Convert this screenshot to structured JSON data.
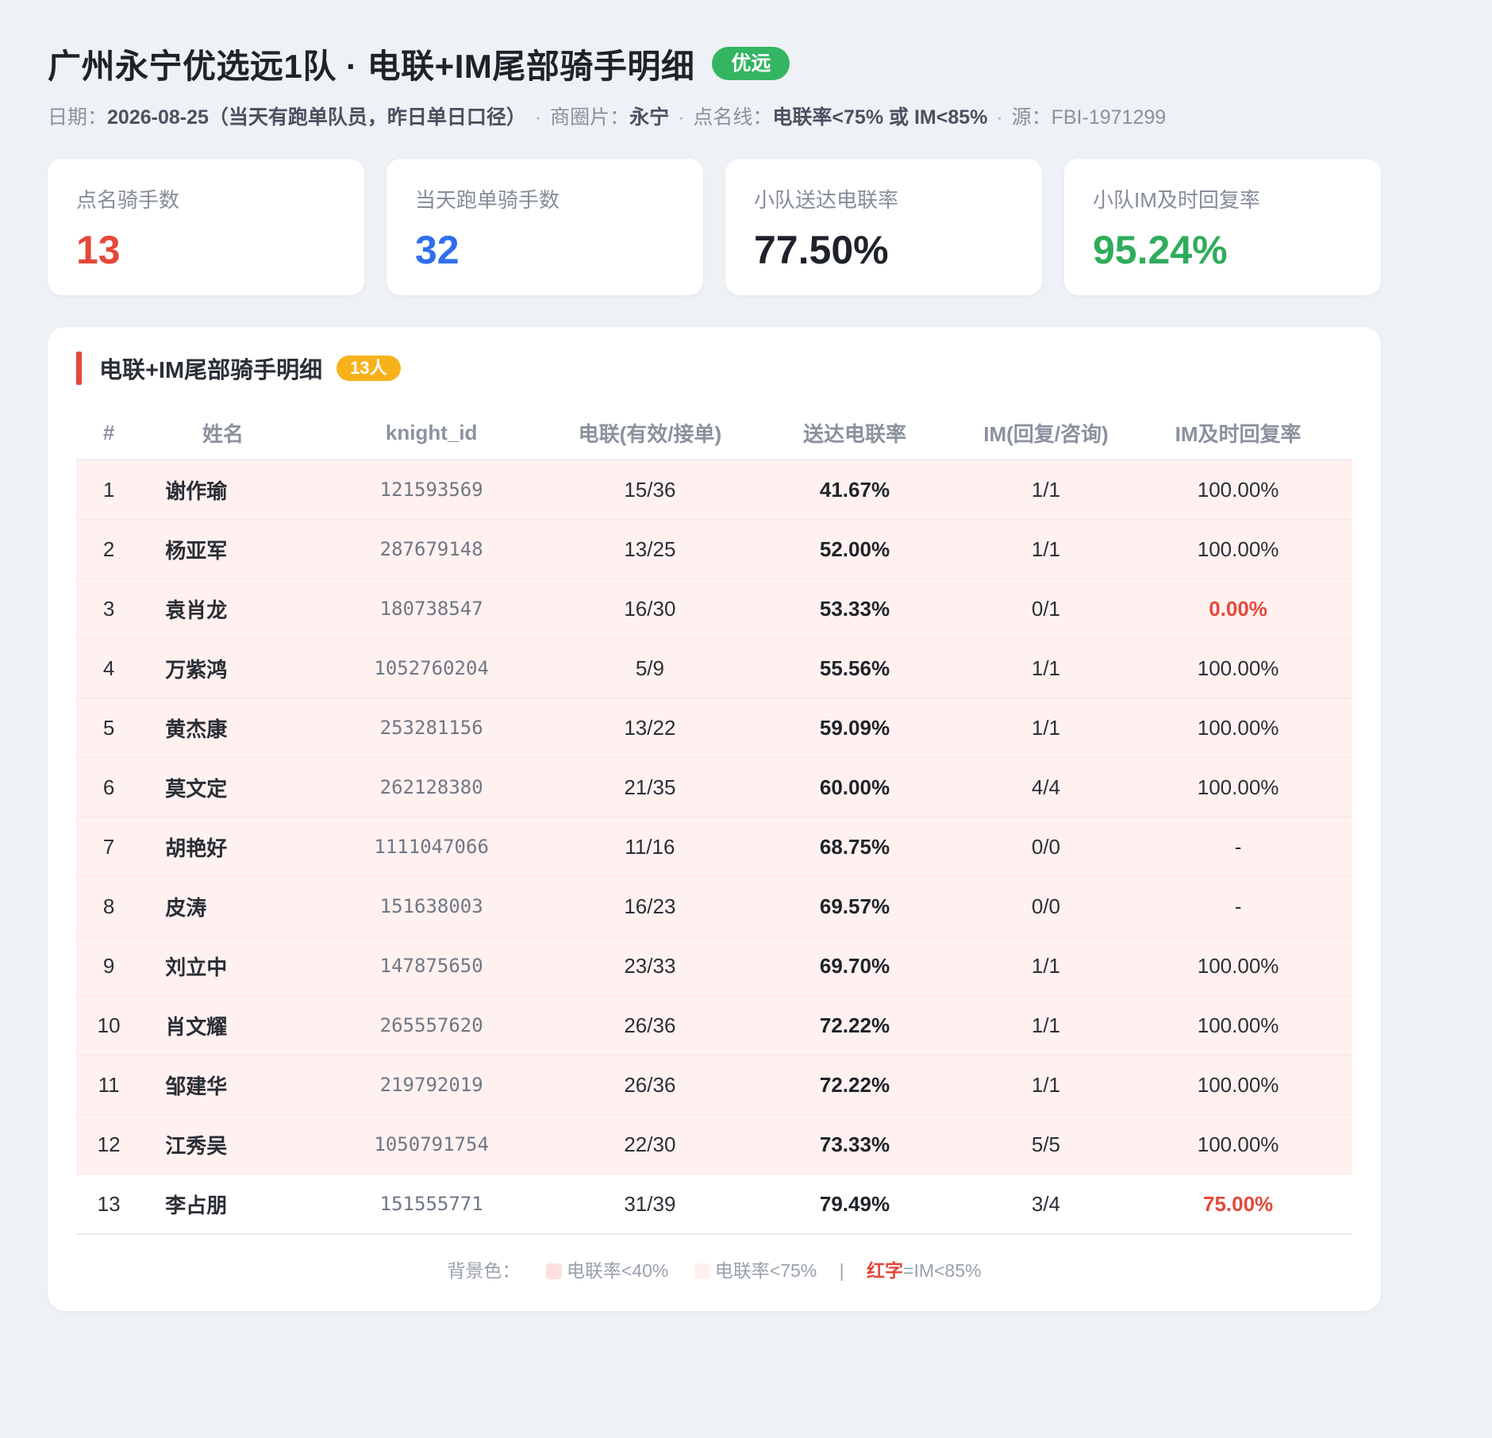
{
  "header": {
    "title": "广州永宁优选远1队 · 电联+IM尾部骑手明细",
    "badge": "优远",
    "date_label": "日期：",
    "date_value": "2026-08-25（当天有跑单队员，昨日单日口径）",
    "area_label": "商圈片：",
    "area_value": "永宁",
    "line_label": "点名线：",
    "line_value": "电联率<75% 或 IM<85%",
    "source_label": "源：",
    "source_value": "FBI-1971299",
    "separator": "·"
  },
  "stats": [
    {
      "label": "点名骑手数",
      "value": "13",
      "color": "#e5483a"
    },
    {
      "label": "当天跑单骑手数",
      "value": "32",
      "color": "#2f6fec"
    },
    {
      "label": "小队送达电联率",
      "value": "77.50%",
      "color": "#1f2329"
    },
    {
      "label": "小队IM及时回复率",
      "value": "95.24%",
      "color": "#2fac5b"
    }
  ],
  "panel": {
    "title": "电联+IM尾部骑手明细",
    "count": "13人",
    "accent_color": "#e5483a"
  },
  "table": {
    "columns": [
      "#",
      "姓名",
      "knight_id",
      "电联(有效/接单)",
      "送达电联率",
      "IM(回复/咨询)",
      "IM及时回复率"
    ],
    "rows": [
      {
        "no": "1",
        "name": "谢作瑜",
        "knight_id": "121593569",
        "call": "15/36",
        "call_rate": "41.67%",
        "im": "1/1",
        "im_rate": "100.00%"
      },
      {
        "no": "2",
        "name": "杨亚军",
        "knight_id": "287679148",
        "call": "13/25",
        "call_rate": "52.00%",
        "im": "1/1",
        "im_rate": "100.00%"
      },
      {
        "no": "3",
        "name": "袁肖龙",
        "knight_id": "180738547",
        "call": "16/30",
        "call_rate": "53.33%",
        "im": "0/1",
        "im_rate": "0.00%"
      },
      {
        "no": "4",
        "name": "万紫鸿",
        "knight_id": "1052760204",
        "call": "5/9",
        "call_rate": "55.56%",
        "im": "1/1",
        "im_rate": "100.00%"
      },
      {
        "no": "5",
        "name": "黄杰康",
        "knight_id": "253281156",
        "call": "13/22",
        "call_rate": "59.09%",
        "im": "1/1",
        "im_rate": "100.00%"
      },
      {
        "no": "6",
        "name": "莫文定",
        "knight_id": "262128380",
        "call": "21/35",
        "call_rate": "60.00%",
        "im": "4/4",
        "im_rate": "100.00%"
      },
      {
        "no": "7",
        "name": "胡艳好",
        "knight_id": "1111047066",
        "call": "11/16",
        "call_rate": "68.75%",
        "im": "0/0",
        "im_rate": "-"
      },
      {
        "no": "8",
        "name": "皮涛",
        "knight_id": "151638003",
        "call": "16/23",
        "call_rate": "69.57%",
        "im": "0/0",
        "im_rate": "-"
      },
      {
        "no": "9",
        "name": "刘立中",
        "knight_id": "147875650",
        "call": "23/33",
        "call_rate": "69.70%",
        "im": "1/1",
        "im_rate": "100.00%"
      },
      {
        "no": "10",
        "name": "肖文耀",
        "knight_id": "265557620",
        "call": "26/36",
        "call_rate": "72.22%",
        "im": "1/1",
        "im_rate": "100.00%"
      },
      {
        "no": "11",
        "name": "邹建华",
        "knight_id": "219792019",
        "call": "26/36",
        "call_rate": "72.22%",
        "im": "1/1",
        "im_rate": "100.00%"
      },
      {
        "no": "12",
        "name": "江秀吴",
        "knight_id": "1050791754",
        "call": "22/30",
        "call_rate": "73.33%",
        "im": "5/5",
        "im_rate": "100.00%"
      },
      {
        "no": "13",
        "name": "李占朋",
        "knight_id": "151555771",
        "call": "31/39",
        "call_rate": "79.49%",
        "im": "3/4",
        "im_rate": "75.00%"
      }
    ]
  },
  "legend": {
    "label": "背景色：",
    "item1": "电联率<40%",
    "item1_color": "#fde0dd",
    "item2": "电联率<75%",
    "item2_color": "#fff1f0",
    "pipe": "|",
    "red_word": "红字",
    "red_rule": "=IM<85%"
  }
}
